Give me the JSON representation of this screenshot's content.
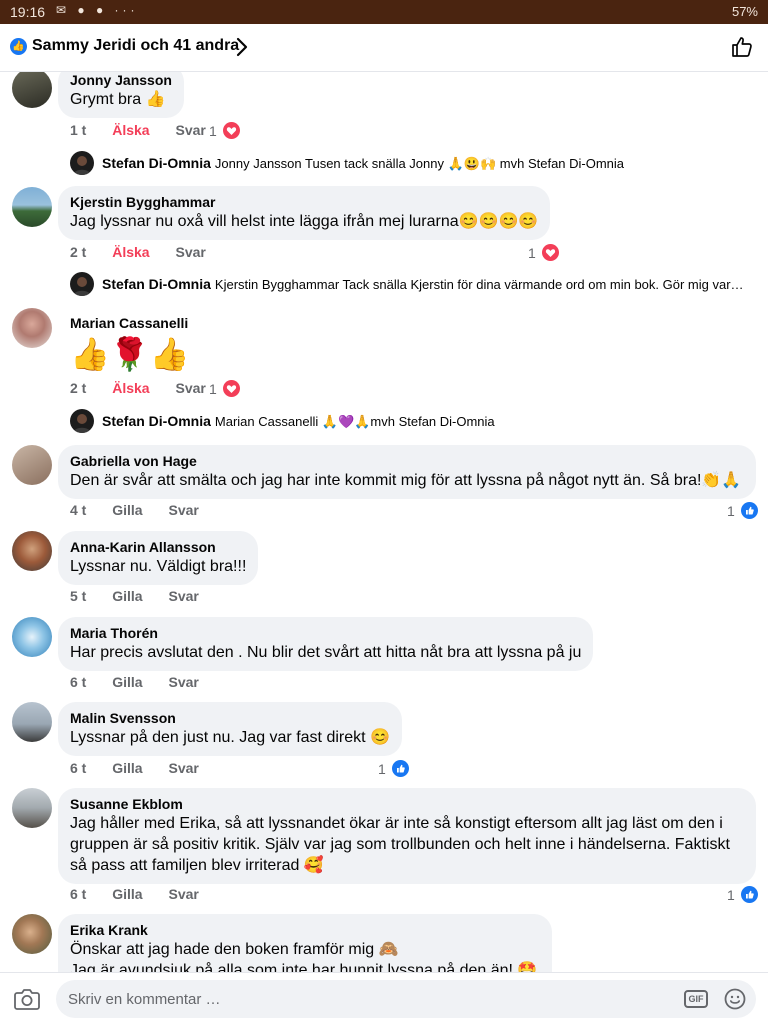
{
  "status_bar": {
    "time": "19:16",
    "icons": "✉ ● ● ···",
    "right": "57%"
  },
  "reactions_header": {
    "text": "Sammy Jeridi och 41 andra"
  },
  "labels": {
    "love": "Älska",
    "like": "Gilla",
    "reply": "Svar"
  },
  "comments": [
    {
      "author": "Jonny Jansson",
      "text": "Grymt bra 👍",
      "time": "1 t",
      "reaction": "love",
      "count": "1",
      "count_icon": "heart"
    },
    {
      "author": "Stefan Di-Omnia",
      "text": "Jonny Jansson Tusen tack snälla  Jonny 🙏😃🙌 mvh Stefan Di-Omnia"
    },
    {
      "author": "Kjerstin Bygghammar",
      "text": "Jag lyssnar nu oxå vill helst inte lägga ifrån mej lurarna😊😊😊😊",
      "time": "2 t",
      "reaction": "love",
      "count": "1",
      "count_icon": "heart"
    },
    {
      "author": "Stefan Di-Omnia",
      "text": "Kjerstin Bygghammar Tack snälla  Kjerstin för dina värmande ord om min bok. Gör mig varm ..."
    },
    {
      "author": "Marian Cassanelli",
      "text": "👍🌹👍",
      "time": "2 t",
      "reaction": "love",
      "count": "1",
      "count_icon": "heart"
    },
    {
      "author": "Stefan Di-Omnia",
      "text": "Marian Cassanelli 🙏💜🙏mvh Stefan Di-Omnia"
    },
    {
      "author": "Gabriella von Hage",
      "text": "Den är svår att smälta och jag har inte kommit mig för att lyssna på något nytt än. Så bra!👏🙏",
      "time": "4 t",
      "reaction": "like",
      "count": "1",
      "count_icon": "like"
    },
    {
      "author": "Anna-Karin Allansson",
      "text": "Lyssnar nu. Väldigt bra!!!",
      "time": "5 t",
      "reaction": "like"
    },
    {
      "author": "Maria Thorén",
      "text": "Har precis avslutat den . Nu blir det svårt att hitta nåt bra att lyssna på ju",
      "time": "6 t",
      "reaction": "like"
    },
    {
      "author": "Malin Svensson",
      "text": "Lyssnar på den just nu. Jag var fast direkt 😊",
      "time": "6 t",
      "reaction": "like",
      "count": "1",
      "count_icon": "like"
    },
    {
      "author": "Susanne Ekblom",
      "text": "Jag håller med Erika, så att lyssnandet ökar är inte så konstigt eftersom allt jag läst om den i gruppen är så positiv kritik. Själv var jag som trollbunden och helt inne i händelserna. Faktiskt så pass att familjen blev irriterad 🥰",
      "time": "6 t",
      "reaction": "like",
      "count": "1",
      "count_icon": "like"
    },
    {
      "author": "Erika Krank",
      "line1": "Önskar att jag hade den boken framför mig 🙈",
      "line2": "Jag är avundsjuk på alla som inte har hunnit lyssna på den än! 🤩"
    }
  ],
  "composer": {
    "placeholder": "Skriv en kommentar …",
    "gif": "GIF"
  },
  "colors": {
    "accent": "#1877f2",
    "love": "#f33e58",
    "bubble": "#f0f2f5",
    "secondary_text": "#65676b",
    "status_bar": "#4a2410"
  },
  "icons": [
    "camera-icon",
    "gif-icon",
    "emoji-icon",
    "thumbs-up-icon",
    "chevron-right-icon",
    "heart-icon",
    "like-icon"
  ]
}
